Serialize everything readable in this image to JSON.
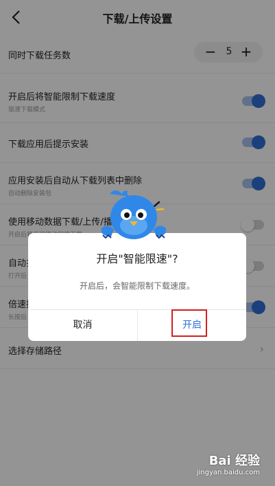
{
  "header": {
    "title": "下载/上传设置",
    "back_icon": "back-arrow-icon"
  },
  "settings": {
    "concurrent": {
      "label": "同时下载任务数",
      "minus": "−",
      "value": "5",
      "plus": "+"
    },
    "items": [
      {
        "label": "开启后将智能限制下载速度",
        "sub": "驱速下载模式",
        "state": "on"
      },
      {
        "label": "下载应用后提示安装",
        "sub": "",
        "state": "on"
      },
      {
        "label": "应用安装后自动从下载列表中删除",
        "sub": "自动删除安装包",
        "state": "on"
      },
      {
        "label": "使用移动数据下载/上传/播",
        "sub": "开启后将使用移动网络下载",
        "state": "off"
      },
      {
        "label": "自动扌",
        "sub": "打开后",
        "state": "off"
      },
      {
        "label": "倍速抗",
        "sub": "长按后",
        "state": "on"
      }
    ],
    "storage": {
      "label": "选择存储路径"
    }
  },
  "dialog": {
    "title": "开启\"智能限速\"?",
    "message": "开启后，会智能限制下载速度。",
    "cancel_label": "取消",
    "confirm_label": "开启"
  },
  "colors": {
    "accent": "#2f6fd6",
    "highlight_box": "#d11f1f"
  },
  "watermark": {
    "main": "Bai 经验",
    "url": "jingyan.baidu.com"
  }
}
